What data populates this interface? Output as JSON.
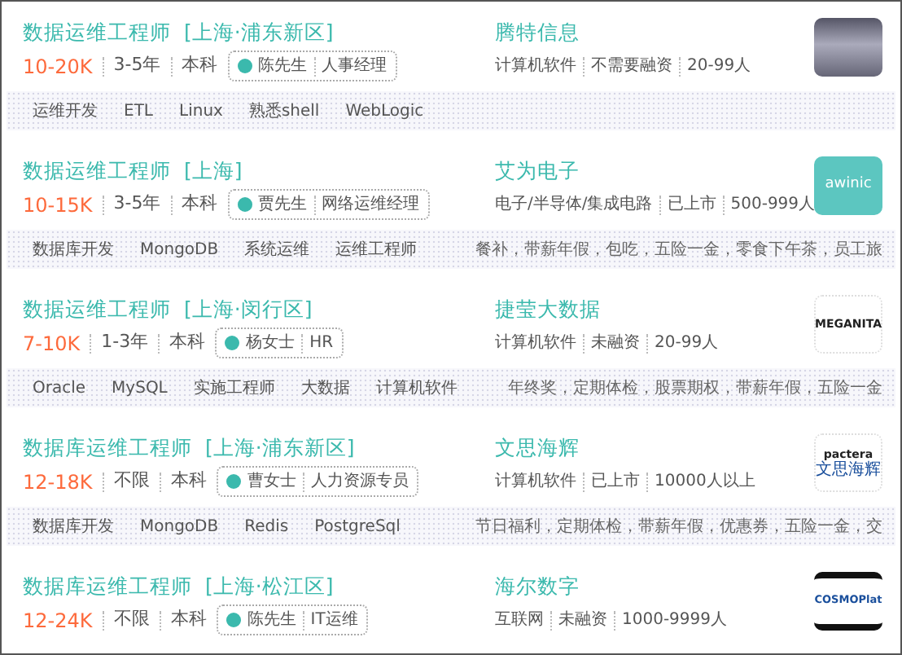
{
  "jobs": [
    {
      "title": "数据运维工程师",
      "location": "[上海·浦东新区]",
      "salary": "10-20K",
      "experience": "3-5年",
      "education": "本科",
      "contact": {
        "name": "陈先生",
        "role": "人事经理"
      },
      "company": {
        "name": "腾特信息",
        "industry": "计算机软件",
        "funding": "不需要融资",
        "size": "20-99人"
      },
      "logo": {
        "kind": "photo"
      },
      "tags": [
        "运维开发",
        "ETL",
        "Linux",
        "熟悉shell",
        "WebLogic"
      ]
    },
    {
      "title": "数据运维工程师",
      "location": "[上海]",
      "salary": "10-15K",
      "experience": "3-5年",
      "education": "本科",
      "contact": {
        "name": "贾先生",
        "role": "网络运维经理"
      },
      "company": {
        "name": "艾为电子",
        "industry": "电子/半导体/集成电路",
        "funding": "已上市",
        "size": "500-999人"
      },
      "logo": {
        "kind": "filled",
        "text": "awinic"
      },
      "tags": [
        "数据库开发",
        "MongoDB",
        "系统运维",
        "运维工程师"
      ],
      "benefits": "餐补，带薪年假，包吃，五险一金，零食下午茶，员工旅"
    },
    {
      "title": "数据运维工程师",
      "location": "[上海·闵行区]",
      "salary": "7-10K",
      "experience": "1-3年",
      "education": "本科",
      "contact": {
        "name": "杨女士",
        "role": "HR"
      },
      "company": {
        "name": "捷莹大数据",
        "industry": "计算机软件",
        "funding": "未融资",
        "size": "20-99人"
      },
      "logo": {
        "kind": "plain",
        "text": "MEGANITA"
      },
      "tags": [
        "Oracle",
        "MySQL",
        "实施工程师",
        "大数据",
        "计算机软件"
      ],
      "benefits": "年终奖，定期体检，股票期权，带薪年假，五险一金"
    },
    {
      "title": "数据库运维工程师",
      "location": "[上海·浦东新区]",
      "salary": "12-18K",
      "experience": "不限",
      "education": "本科",
      "contact": {
        "name": "曹女士",
        "role": "人力资源专员"
      },
      "company": {
        "name": "文思海辉",
        "industry": "计算机软件",
        "funding": "已上市",
        "size": "10000人以上"
      },
      "logo": {
        "kind": "plain",
        "text": "pactera",
        "subtext": "文思海辉"
      },
      "tags": [
        "数据库开发",
        "MongoDB",
        "Redis",
        "PostgreSql"
      ],
      "benefits": "节日福利，定期体检，带薪年假，优惠券，五险一金，交"
    },
    {
      "title": "数据库运维工程师",
      "location": "[上海·松江区]",
      "salary": "12-24K",
      "experience": "不限",
      "education": "本科",
      "contact": {
        "name": "陈先生",
        "role": "IT运维"
      },
      "company": {
        "name": "海尔数字",
        "industry": "互联网",
        "funding": "未融资",
        "size": "1000-9999人"
      },
      "logo": {
        "kind": "banded",
        "text": "COSMOPlat"
      }
    }
  ]
}
